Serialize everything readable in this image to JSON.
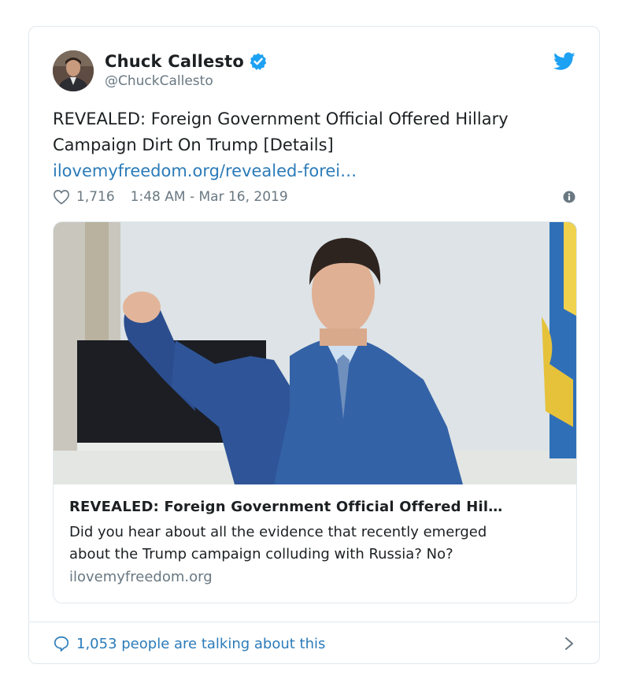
{
  "tweet": {
    "author_name": "Chuck Callesto",
    "author_handle": "@ChuckCallesto",
    "text_line1": "REVEALED: Foreign Government Official Offered Hillary",
    "text_line2": "Campaign Dirt On Trump [Details]",
    "link_text": "ilovemyfreedom.org/revealed-forei…",
    "likes": "1,716",
    "timestamp": "1:48 AM - Mar 16, 2019"
  },
  "link_card": {
    "title": "REVEALED: Foreign Government Official Offered Hil…",
    "description_line1": "Did you hear about all the evidence that recently emerged",
    "description_line2": "about the Trump campaign colluding with Russia? No?",
    "domain": "ilovemyfreedom.org"
  },
  "footer": {
    "talking_text": "1,053 people are talking about this"
  },
  "icons": {
    "verified": "verified-badge-icon",
    "twitter": "twitter-bird-icon",
    "heart": "heart-icon",
    "info": "info-icon",
    "comment": "speech-bubble-icon",
    "chevron": "chevron-right-icon"
  },
  "colors": {
    "link": "#2b7bb9",
    "verified": "#1da1f2",
    "text": "#1c2022",
    "muted": "#697882",
    "border": "#e1e8ed"
  }
}
